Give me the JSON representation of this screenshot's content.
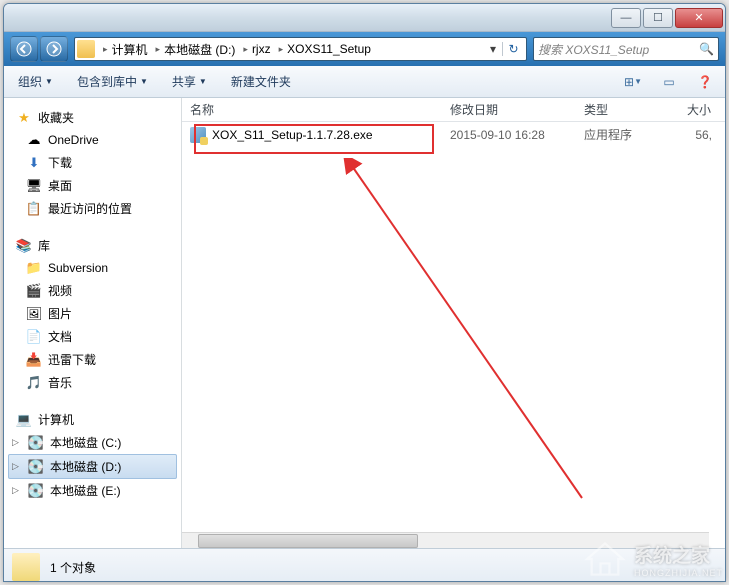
{
  "breadcrumb": {
    "items": [
      "计算机",
      "本地磁盘 (D:)",
      "rjxz",
      "XOXS11_Setup"
    ]
  },
  "search": {
    "placeholder": "搜索 XOXS11_Setup"
  },
  "toolbar": {
    "organize": "组织",
    "include": "包含到库中",
    "share": "共享",
    "newfolder": "新建文件夹"
  },
  "columns": {
    "name": "名称",
    "date": "修改日期",
    "type": "类型",
    "size": "大小"
  },
  "files": [
    {
      "name": "XOX_S11_Setup-1.1.7.28.exe",
      "date": "2015-09-10 16:28",
      "type": "应用程序",
      "size": "56,"
    }
  ],
  "sidebar": {
    "favorites": {
      "label": "收藏夹",
      "items": [
        {
          "label": "OneDrive",
          "icon": "☁"
        },
        {
          "label": "下载",
          "icon": "⬇"
        },
        {
          "label": "桌面",
          "icon": "🖥"
        },
        {
          "label": "最近访问的位置",
          "icon": "📋"
        }
      ]
    },
    "libraries": {
      "label": "库",
      "items": [
        {
          "label": "Subversion",
          "icon": "📁"
        },
        {
          "label": "视频",
          "icon": "🎬"
        },
        {
          "label": "图片",
          "icon": "🖼"
        },
        {
          "label": "文档",
          "icon": "📄"
        },
        {
          "label": "迅雷下载",
          "icon": "📥"
        },
        {
          "label": "音乐",
          "icon": "🎵"
        }
      ]
    },
    "computer": {
      "label": "计算机",
      "items": [
        {
          "label": "本地磁盘 (C:)",
          "icon": "💽"
        },
        {
          "label": "本地磁盘 (D:)",
          "icon": "💽",
          "selected": true
        },
        {
          "label": "本地磁盘 (E:)",
          "icon": "💽"
        }
      ]
    }
  },
  "status": {
    "count": "1 个对象"
  },
  "watermark": {
    "text": "系统之家",
    "sub": "HONGZHIJIA.NET"
  }
}
